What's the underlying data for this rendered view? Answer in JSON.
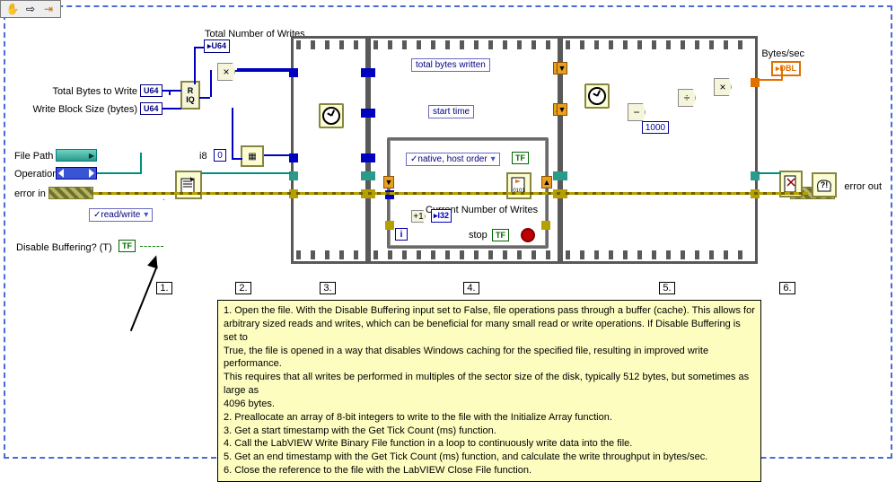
{
  "toolbar": {
    "tool_hand": "✋",
    "tool_arrow": "⇨",
    "tool_step": "⇥"
  },
  "labels": {
    "total_writes": "Total Number of Writes",
    "total_bytes": "Total Bytes to Write",
    "block_size": "Write Block Size (bytes)",
    "file_path": "File Path",
    "operation": "Operation",
    "error_in": "error in",
    "disable_buf": "Disable Buffering? (T)",
    "bytes_sec": "Bytes/sec",
    "error_out": "error out",
    "i8": "i8",
    "byte_order_opt": "native, host order",
    "read_write_opt": "read/write",
    "total_bytes_written": "total bytes written",
    "start_time": "start time",
    "current_writes": "Current Number of Writes",
    "stop": "stop",
    "const_zero": "0",
    "const_1000": "1000"
  },
  "terms": {
    "u64": "U64",
    "tf": "TF",
    "i32": "I32",
    "dbl": "DBL"
  },
  "steps": {
    "s1": "1.",
    "s2": "2.",
    "s3": "3.",
    "s4": "4.",
    "s5": "5.",
    "s6": "6."
  },
  "desc": {
    "l1": "1. Open the file.  With the Disable Buffering input set to False, file operations pass through a buffer (cache). This allows for",
    "l2": "arbitrary sized reads and writes, which can be beneficial for many small read or write operations.  If Disable Buffering is set to",
    "l3": "True, the file is opened in a way that disables Windows caching for the specified file, resulting in improved write performance.",
    "l4": "This requires that all writes be performed in multiples of the sector size of the disk, typically 512 bytes, but sometimes as large as",
    "l5": "4096 bytes.",
    "l6": "2. Preallocate an array of 8-bit integers to write to the file with the Initialize Array function.",
    "l7": "3. Get a start timestamp with the Get Tick Count (ms) function.",
    "l8": "4. Call the LabVIEW Write Binary File function in a loop to continuously write data into the file.",
    "l9": "5. Get an end timestamp with the Get Tick Count (ms) function, and calculate the write throughput in bytes/sec.",
    "l10": "6. Close the reference to the file with the LabVIEW Close File function."
  }
}
